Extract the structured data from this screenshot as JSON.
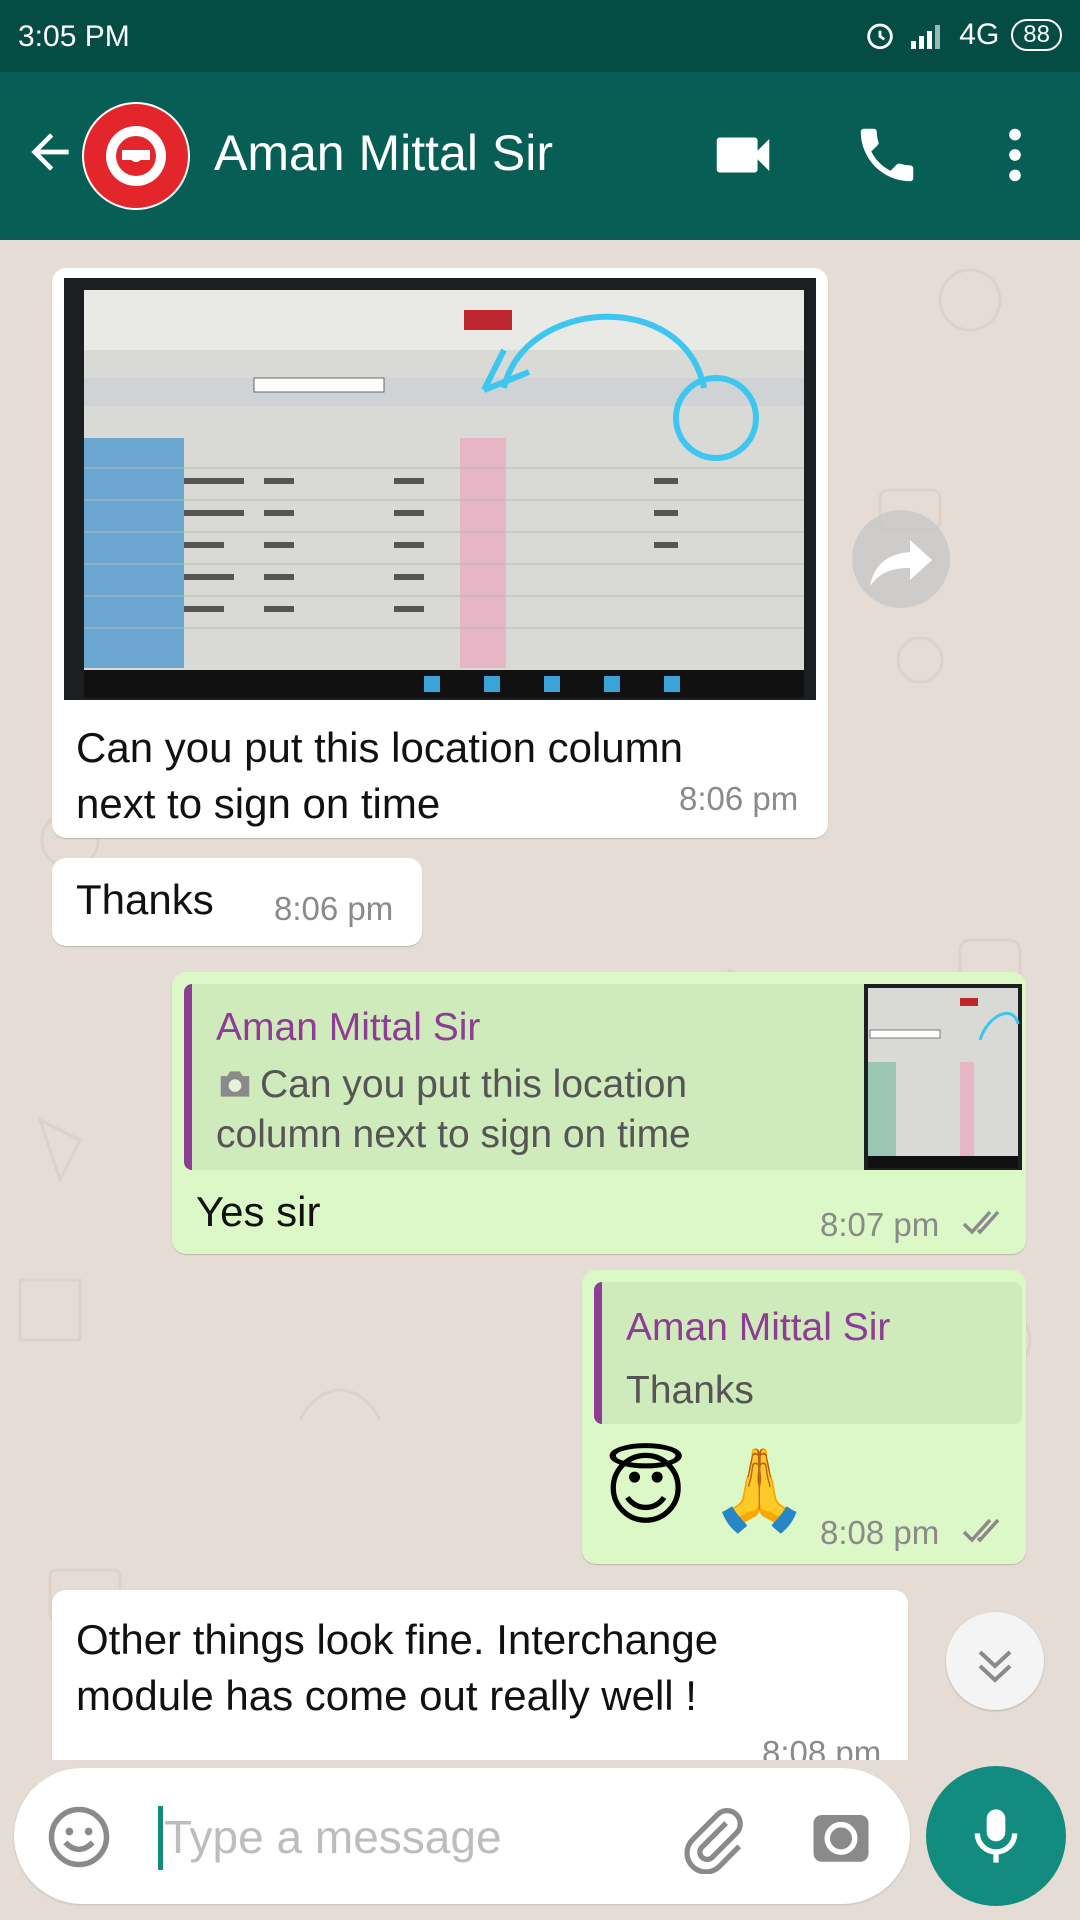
{
  "status_bar": {
    "time": "3:05 PM",
    "network": "4G",
    "battery": "88"
  },
  "header": {
    "contact_name": "Aman Mittal Sir"
  },
  "messages": {
    "m1": {
      "photo_caption": "Can you put this location column next to sign on time",
      "caption_line1": "Can you put this location column",
      "caption_line2": "next to sign on time",
      "time": "8:06 pm"
    },
    "m2": {
      "text": "Thanks",
      "time": "8:06 pm"
    },
    "m3": {
      "quote_author": "Aman Mittal Sir",
      "quote_line1": "Can you put this location",
      "quote_line2": "column next to sign on time",
      "text": "Yes sir",
      "time": "8:07 pm"
    },
    "m4": {
      "quote_author": "Aman Mittal Sir",
      "quote_text": "Thanks",
      "emojis": "😇 🙏",
      "time": "8:08 pm"
    },
    "m5": {
      "line1": "Other things look fine. Interchange",
      "line2": "module has come out really well !",
      "time": "8:08 pm"
    }
  },
  "input": {
    "placeholder": "Type a message"
  },
  "colors": {
    "header": "#075e54",
    "status_bar": "#054d44",
    "outgoing": "#dcf8c6",
    "accent": "#128c7e",
    "quote_author": "#8e3d95"
  },
  "icons": [
    "back-arrow-icon",
    "video-call-icon",
    "phone-icon",
    "more-vert-icon",
    "forward-icon",
    "scroll-down-icon",
    "emoji-icon",
    "attach-icon",
    "camera-icon",
    "mic-icon"
  ]
}
